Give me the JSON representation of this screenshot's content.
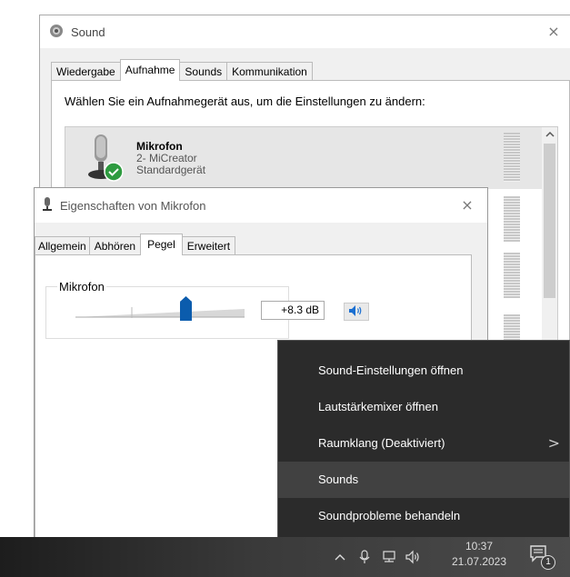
{
  "sound_window": {
    "title": "Sound",
    "close": "×",
    "tabs": [
      {
        "label": "Wiedergabe"
      },
      {
        "label": "Aufnahme"
      },
      {
        "label": "Sounds"
      },
      {
        "label": "Kommunikation"
      }
    ],
    "instruction": "Wählen Sie ein Aufnahmegerät aus, um die Einstellungen zu ändern:",
    "device": {
      "name": "Mikrofon",
      "model": "2- MiCreator",
      "status": "Standardgerät"
    },
    "scroll_up": "^"
  },
  "properties_window": {
    "title": "Eigenschaften von Mikrofon",
    "close": "×",
    "tabs": [
      {
        "label": "Allgemein"
      },
      {
        "label": "Abhören"
      },
      {
        "label": "Pegel"
      },
      {
        "label": "Erweitert"
      }
    ],
    "group_label": "Mikrofon",
    "level_value": "+8.3 dB",
    "slider_level": 0.7
  },
  "context_menu": {
    "items": [
      {
        "label": "Sound-Einstellungen öffnen"
      },
      {
        "label": "Lautstärkemixer öffnen"
      },
      {
        "label": "Raumklang (Deaktiviert)",
        "chevron": ">"
      },
      {
        "label": "Sounds"
      },
      {
        "label": "Soundprobleme behandeln"
      }
    ]
  },
  "taskbar": {
    "overflow_chevron": "^",
    "time": "10:37",
    "date": "21.07.2023",
    "notification_count": "1"
  },
  "colors": {
    "accent": "#0b5cad",
    "menu_bg": "#2b2b2b",
    "menu_hover": "#414141",
    "default_badge": "#2e9b40"
  }
}
